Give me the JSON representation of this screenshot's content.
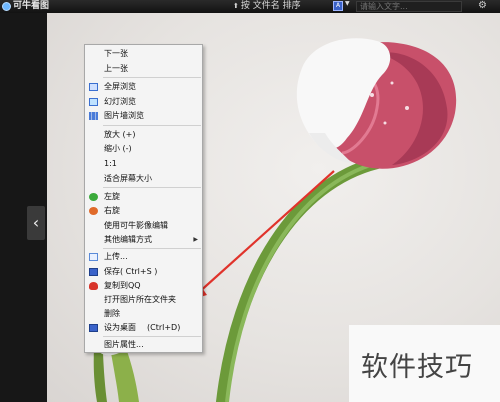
{
  "topbar": {
    "app_title": "可牛看图",
    "sort_label": "按 文件名 排序",
    "search_placeholder": "请输入文字..."
  },
  "context_menu": {
    "items": [
      {
        "label": "下一张"
      },
      {
        "label": "上一张"
      },
      {
        "label": "全屏浏览"
      },
      {
        "label": "幻灯浏览"
      },
      {
        "label": "图片墙浏览"
      },
      {
        "label": "放大 (+)"
      },
      {
        "label": "缩小 (-)"
      },
      {
        "label": "1:1"
      },
      {
        "label": "适合屏幕大小"
      },
      {
        "label": "左旋"
      },
      {
        "label": "右旋"
      },
      {
        "label": "使用可牛影像编辑"
      },
      {
        "label": "其他编辑方式"
      },
      {
        "label": "上传..."
      },
      {
        "label": "保存( Ctrl+S )"
      },
      {
        "label": "复制到QQ"
      },
      {
        "label": "打开图片所在文件夹"
      },
      {
        "label": "删除"
      },
      {
        "label": "设为桌面",
        "shortcut": "(Ctrl+D)"
      },
      {
        "label": "图片属性..."
      }
    ]
  },
  "watermark": "软件技巧",
  "colors": {
    "annotation_arrow": "#e0332b",
    "petal": "#c8506a",
    "stem": "#6c9a3a"
  }
}
